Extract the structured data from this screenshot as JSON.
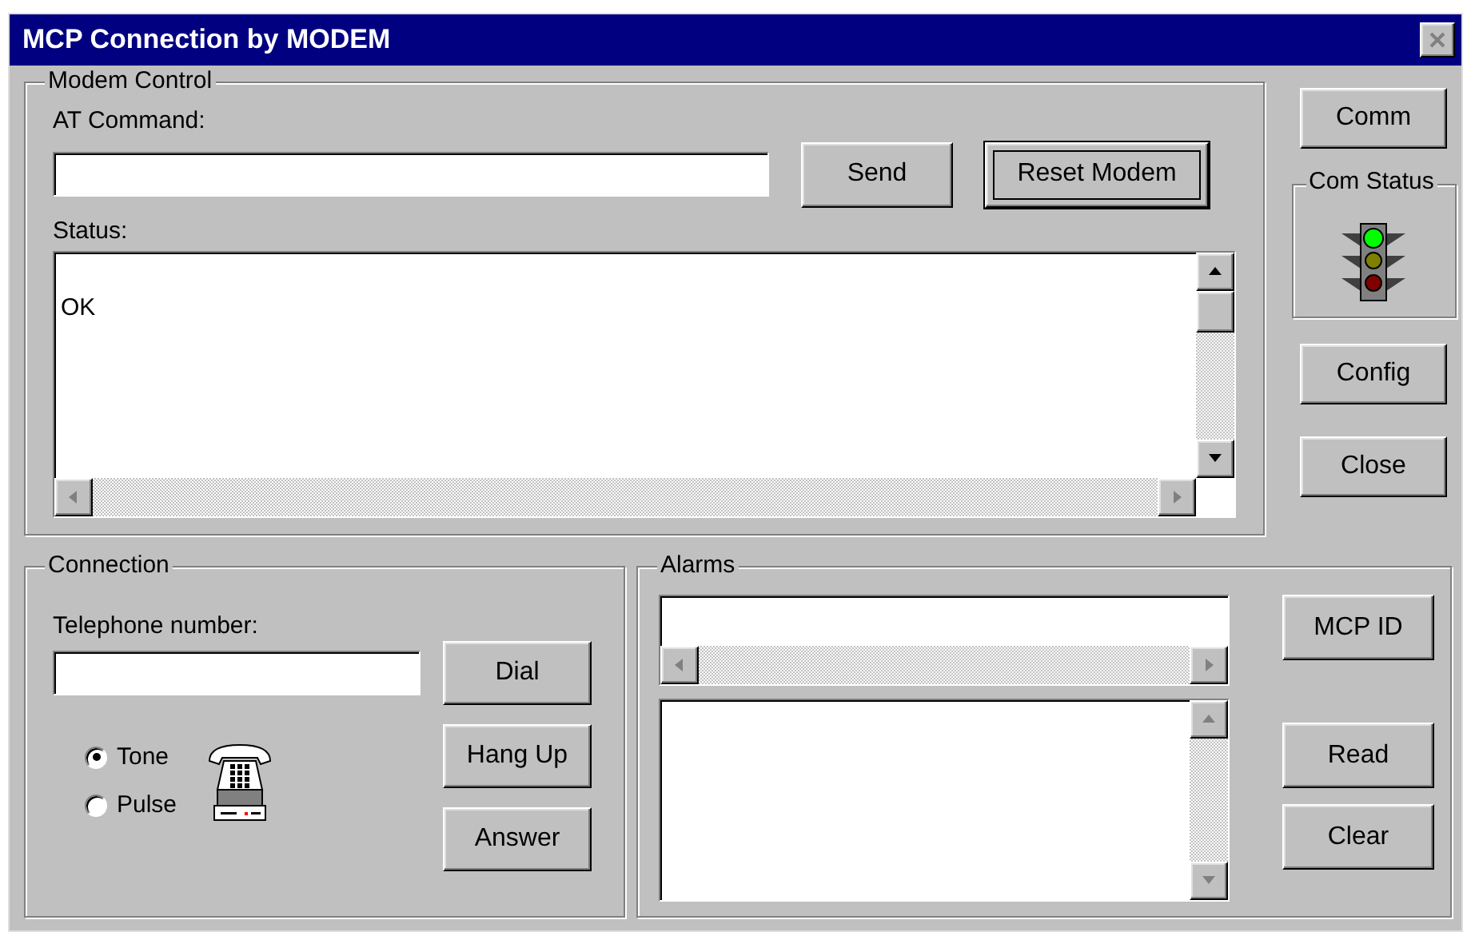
{
  "window": {
    "title": "MCP Connection by MODEM"
  },
  "modem_control": {
    "title": "Modem Control",
    "at_command_label": "AT Command:",
    "send_button": "Send",
    "reset_button": {
      "label": "Reset Modem",
      "focused": true
    },
    "status_label": "Status:",
    "status_lines": [
      "OK"
    ]
  },
  "side": [
    {
      "kind": "button",
      "label": "Comm"
    },
    {
      "kind": "status",
      "title": "Com Status",
      "lamps": [
        {
          "lit": true
        },
        {
          "lit": false
        },
        {
          "lit": false
        }
      ]
    },
    {
      "kind": "button",
      "label": "Config"
    },
    {
      "kind": "button",
      "label": "Close"
    }
  ],
  "connection": {
    "title": "Connection",
    "phone_label": "Telephone number:",
    "dial_modes": [
      {
        "label": "Tone",
        "selected": true
      },
      {
        "label": "Pulse",
        "selected": false
      }
    ],
    "buttons": [
      "Dial",
      "Hang Up",
      "Answer"
    ]
  },
  "alarms": {
    "title": "Alarms",
    "buttons": [
      "MCP ID",
      "Read",
      "Clear"
    ]
  }
}
